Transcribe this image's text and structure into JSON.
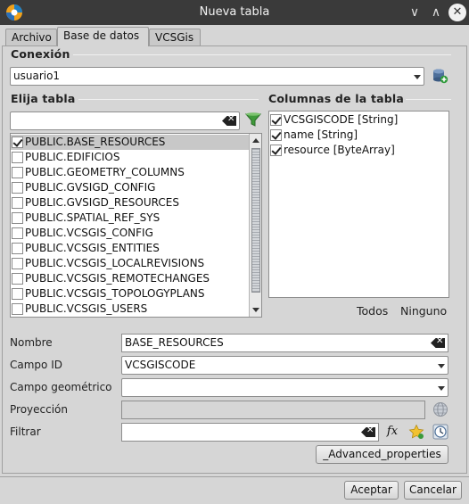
{
  "window": {
    "title": "Nueva tabla",
    "minimize_glyph": "∨",
    "maximize_glyph": "∧",
    "close_glyph": "✕"
  },
  "tabs": [
    {
      "label": "Archivo",
      "active": false
    },
    {
      "label": "Base de datos",
      "active": true
    },
    {
      "label": "VCSGis",
      "active": false
    }
  ],
  "connection": {
    "section_label": "Conexión",
    "selected": "usuario1",
    "add_icon": "database-add-icon"
  },
  "tables": {
    "section_label": "Elija tabla",
    "filter_value": "",
    "items": [
      {
        "label": "PUBLIC.BASE_RESOURCES",
        "checked": true,
        "selected": true
      },
      {
        "label": "PUBLIC.EDIFICIOS",
        "checked": false,
        "selected": false
      },
      {
        "label": "PUBLIC.GEOMETRY_COLUMNS",
        "checked": false,
        "selected": false
      },
      {
        "label": "PUBLIC.GVSIGD_CONFIG",
        "checked": false,
        "selected": false
      },
      {
        "label": "PUBLIC.GVSIGD_RESOURCES",
        "checked": false,
        "selected": false
      },
      {
        "label": "PUBLIC.SPATIAL_REF_SYS",
        "checked": false,
        "selected": false
      },
      {
        "label": "PUBLIC.VCSGIS_CONFIG",
        "checked": false,
        "selected": false
      },
      {
        "label": "PUBLIC.VCSGIS_ENTITIES",
        "checked": false,
        "selected": false
      },
      {
        "label": "PUBLIC.VCSGIS_LOCALREVISIONS",
        "checked": false,
        "selected": false
      },
      {
        "label": "PUBLIC.VCSGIS_REMOTECHANGES",
        "checked": false,
        "selected": false
      },
      {
        "label": "PUBLIC.VCSGIS_TOPOLOGYPLANS",
        "checked": false,
        "selected": false
      },
      {
        "label": "PUBLIC.VCSGIS_USERS",
        "checked": false,
        "selected": false
      }
    ]
  },
  "columns": {
    "section_label": "Columnas de la tabla",
    "items": [
      {
        "label": "VCSGISCODE [String]",
        "checked": true
      },
      {
        "label": "name [String]",
        "checked": true
      },
      {
        "label": "resource [ByteArray]",
        "checked": true
      }
    ],
    "all_label": "Todos",
    "none_label": "Ninguno"
  },
  "form": {
    "name_label": "Nombre",
    "name_value": "BASE_RESOURCES",
    "id_label": "Campo ID",
    "id_value": "VCSGISCODE",
    "geom_label": "Campo geométrico",
    "geom_value": "",
    "proj_label": "Proyección",
    "proj_value": "",
    "filter_label": "Filtrar",
    "filter_value": "",
    "advanced_label": "_Advanced_properties"
  },
  "footer": {
    "accept_label": "Aceptar",
    "cancel_label": "Cancelar"
  }
}
